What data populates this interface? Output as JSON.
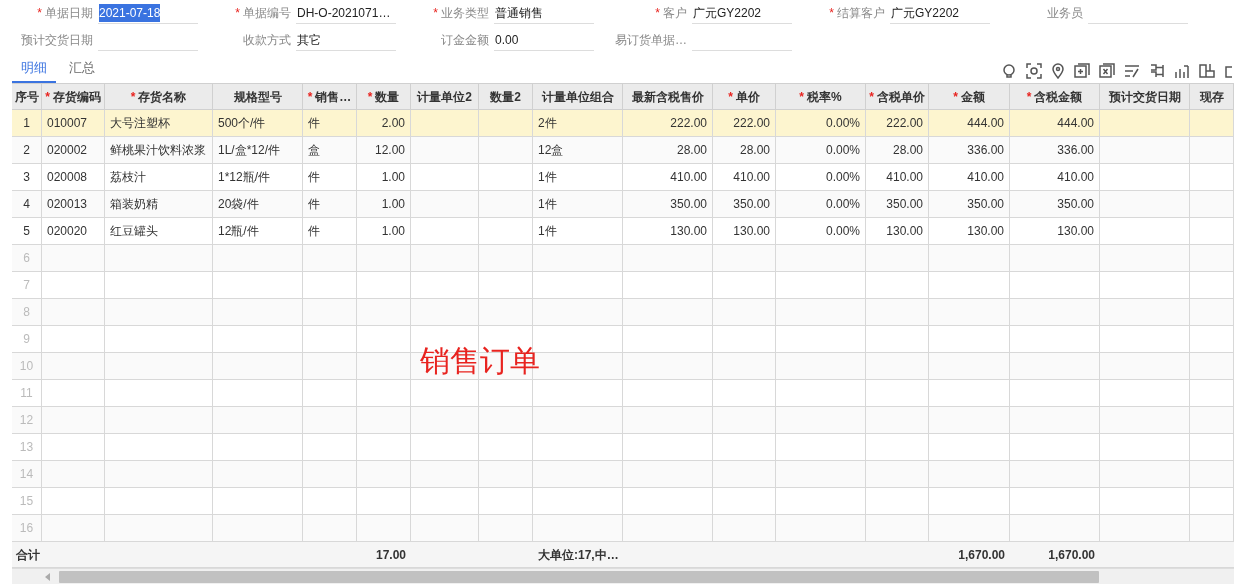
{
  "form": {
    "fields": [
      {
        "required_mark": "*",
        "label": "单据日期",
        "value": "2021-07-18",
        "highlighted": true
      },
      {
        "required_mark": "*",
        "label": "单据编号",
        "value": "DH-O-2021071…",
        "highlighted": false
      },
      {
        "required_mark": "*",
        "label": "业务类型",
        "value": "普通销售",
        "highlighted": false
      },
      {
        "required_mark": "*",
        "label": "客户",
        "value": "广元GY2202",
        "highlighted": false
      },
      {
        "required_mark": "*",
        "label": "结算客户",
        "value": "广元GY2202",
        "highlighted": false
      },
      {
        "label": "业务员"
      },
      {
        "label": "预计交货日期"
      },
      {
        "label": "收款方式",
        "value": "其它",
        "highlighted": false
      },
      {
        "label": "订金金额",
        "value": "0.00",
        "highlighted": false
      },
      {
        "label": "易订货单据…"
      }
    ]
  },
  "tabs": [
    {
      "label": "明细",
      "selected": true
    },
    {
      "label": "汇总",
      "selected": false
    }
  ],
  "table": {
    "columns": [
      {
        "label": "序号",
        "kind": "center"
      },
      {
        "required_mark": "*",
        "label": "存货编码",
        "kind": "text"
      },
      {
        "required_mark": "*",
        "label": "存货名称",
        "kind": "text"
      },
      {
        "label": "规格型号",
        "kind": "text"
      },
      {
        "required_mark": "*",
        "label": "销售…",
        "kind": "text"
      },
      {
        "required_mark": "*",
        "label": "数量",
        "kind": "number"
      },
      {
        "label": "计量单位2",
        "kind": "text"
      },
      {
        "label": "数量2",
        "kind": "number"
      },
      {
        "label": "计量单位组合",
        "kind": "text"
      },
      {
        "label": "最新含税售价",
        "kind": "number"
      },
      {
        "required_mark": "*",
        "label": "单价",
        "kind": "number"
      },
      {
        "required_mark": "*",
        "label": "税率%",
        "kind": "number"
      },
      {
        "required_mark": "*",
        "label": "含税单价",
        "kind": "number"
      },
      {
        "required_mark": "*",
        "label": "金额",
        "kind": "number"
      },
      {
        "required_mark": "*",
        "label": "含税金额",
        "kind": "number"
      },
      {
        "label": "预计交货日期",
        "kind": "text"
      },
      {
        "label": "现存",
        "kind": "text"
      }
    ],
    "rows": [
      {
        "selected": true,
        "cells": [
          "1",
          "010007",
          "大号注塑杯",
          "500个/件",
          "件",
          "2.00",
          null,
          null,
          "2件",
          "222.00",
          "222.00",
          "0.00%",
          "222.00",
          "444.00",
          "444.00",
          null,
          null
        ]
      },
      {
        "selected": false,
        "cells": [
          "2",
          "020002",
          "鲜桃果汁饮料浓浆",
          "1L/盒*12/件",
          "盒",
          "12.00",
          null,
          null,
          "12盒",
          "28.00",
          "28.00",
          "0.00%",
          "28.00",
          "336.00",
          "336.00",
          null,
          null
        ]
      },
      {
        "selected": false,
        "cells": [
          "3",
          "020008",
          "荔枝汁",
          "1*12瓶/件",
          "件",
          "1.00",
          null,
          null,
          "1件",
          "410.00",
          "410.00",
          "0.00%",
          "410.00",
          "410.00",
          "410.00",
          null,
          null
        ]
      },
      {
        "selected": false,
        "cells": [
          "4",
          "020013",
          "箱装奶精",
          "20袋/件",
          "件",
          "1.00",
          null,
          null,
          "1件",
          "350.00",
          "350.00",
          "0.00%",
          "350.00",
          "350.00",
          "350.00",
          null,
          null
        ]
      },
      {
        "selected": false,
        "cells": [
          "5",
          "020020",
          "红豆罐头",
          "12瓶/件",
          "件",
          "1.00",
          null,
          null,
          "1件",
          "130.00",
          "130.00",
          "0.00%",
          "130.00",
          "130.00",
          "130.00",
          null,
          null
        ]
      }
    ],
    "empty_rows": [
      "6",
      "7",
      "8",
      "9",
      "10",
      "11",
      "12",
      "13",
      "14",
      "15",
      "16"
    ],
    "totals": {
      "label": "合计",
      "cells": [
        null,
        null,
        null,
        null,
        null,
        "17.00",
        null,
        null,
        "大单位:17,中…",
        null,
        null,
        null,
        null,
        "1,670.00",
        "1,670.00",
        null,
        null
      ]
    }
  },
  "annotation": "销售订单"
}
